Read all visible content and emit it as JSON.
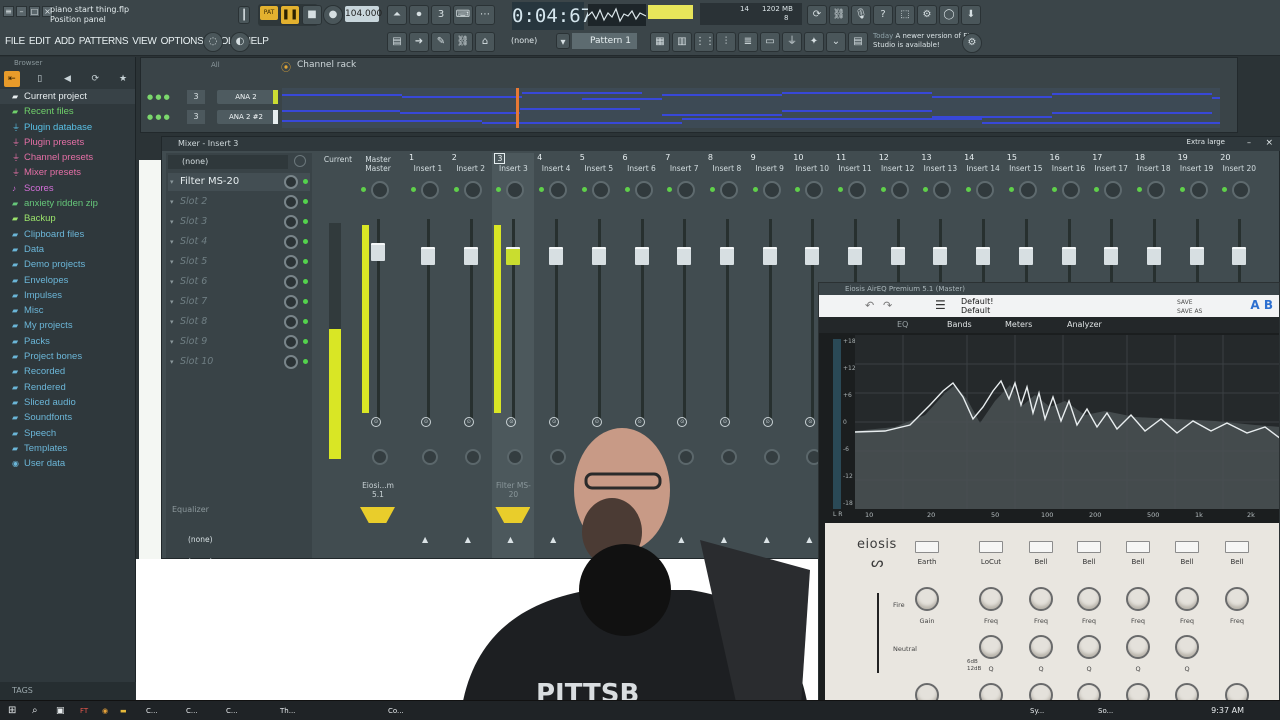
{
  "topbar": {
    "file_name": "piano start thing.flp",
    "hint": "Position panel",
    "menu": [
      "FILE",
      "EDIT",
      "ADD",
      "PATTERNS",
      "VIEW",
      "OPTIONS",
      "TOOLS",
      "HELP"
    ],
    "pat_label": "PAT",
    "tempo": "104.000",
    "time": "0:04:67",
    "cpu_value": "14",
    "ram_value": "1202 MB",
    "voices": "8",
    "route_select": "(none)",
    "pattern": "Pattern 1",
    "news_label": "Today",
    "news_text": "A newer version of FL Studio is available!"
  },
  "browser": {
    "title": "Browser",
    "items": [
      {
        "label": "Current project",
        "color": "#e8eef0",
        "icon": "folder-icon"
      },
      {
        "label": "Recent files",
        "color": "#6fcf6a",
        "icon": "folder-icon"
      },
      {
        "label": "Plugin database",
        "color": "#59c0e6",
        "icon": "plug-icon"
      },
      {
        "label": "Plugin presets",
        "color": "#e56fa6",
        "icon": "plug-icon"
      },
      {
        "label": "Channel presets",
        "color": "#e56fa6",
        "icon": "plug-icon"
      },
      {
        "label": "Mixer presets",
        "color": "#e56fa6",
        "icon": "plug-icon"
      },
      {
        "label": "Scores",
        "color": "#d36fd8",
        "icon": "note-icon"
      },
      {
        "label": "anxiety ridden zip",
        "color": "#66c77a",
        "icon": "folder-icon"
      },
      {
        "label": "Backup",
        "color": "#9be36b",
        "icon": "folder-icon"
      },
      {
        "label": "Clipboard files",
        "color": "#6bb6d8",
        "icon": "folder-icon"
      },
      {
        "label": "Data",
        "color": "#6bb6d8",
        "icon": "folder-icon"
      },
      {
        "label": "Demo projects",
        "color": "#6bb6d8",
        "icon": "folder-icon"
      },
      {
        "label": "Envelopes",
        "color": "#6bb6d8",
        "icon": "folder-icon"
      },
      {
        "label": "Impulses",
        "color": "#6bb6d8",
        "icon": "folder-icon"
      },
      {
        "label": "Misc",
        "color": "#6bb6d8",
        "icon": "folder-icon"
      },
      {
        "label": "My projects",
        "color": "#6bb6d8",
        "icon": "folder-icon"
      },
      {
        "label": "Packs",
        "color": "#6bb6d8",
        "icon": "folder-icon"
      },
      {
        "label": "Project bones",
        "color": "#6bb6d8",
        "icon": "folder-icon"
      },
      {
        "label": "Recorded",
        "color": "#6bb6d8",
        "icon": "folder-icon"
      },
      {
        "label": "Rendered",
        "color": "#6bb6d8",
        "icon": "folder-icon"
      },
      {
        "label": "Sliced audio",
        "color": "#6bb6d8",
        "icon": "folder-icon"
      },
      {
        "label": "Soundfonts",
        "color": "#6bb6d8",
        "icon": "folder-icon"
      },
      {
        "label": "Speech",
        "color": "#6bb6d8",
        "icon": "folder-icon"
      },
      {
        "label": "Templates",
        "color": "#6bb6d8",
        "icon": "folder-icon"
      },
      {
        "label": "User data",
        "color": "#6bb6d8",
        "icon": "user-icon"
      }
    ],
    "filter": "All",
    "tags": "TAGS"
  },
  "channel_rack": {
    "title": "Channel rack",
    "rows": [
      {
        "num": "3",
        "name": "ANA 2"
      },
      {
        "num": "3",
        "name": "ANA 2 #2"
      }
    ]
  },
  "mixer": {
    "title": "Mixer - Insert 3",
    "size_label": "Extra large",
    "preset": "(none)",
    "slots": [
      {
        "label": "Filter MS-20",
        "active": true
      },
      {
        "label": "Slot 2",
        "active": false
      },
      {
        "label": "Slot 3",
        "active": false
      },
      {
        "label": "Slot 4",
        "active": false
      },
      {
        "label": "Slot 5",
        "active": false
      },
      {
        "label": "Slot 6",
        "active": false
      },
      {
        "label": "Slot 7",
        "active": false
      },
      {
        "label": "Slot 8",
        "active": false
      },
      {
        "label": "Slot 9",
        "active": false
      },
      {
        "label": "Slot 10",
        "active": false
      }
    ],
    "eq_label": "Equalizer",
    "route_in": "(none)",
    "route_out": "(none)",
    "current_label": "Current",
    "master_top": "Master",
    "master_name": "Master",
    "master_fx": "Eiosi...m 5.1",
    "insert3_fx": "Filter MS-20",
    "inserts": [
      {
        "num": "1",
        "name": "Insert 1"
      },
      {
        "num": "2",
        "name": "Insert 2"
      },
      {
        "num": "3",
        "name": "Insert 3"
      },
      {
        "num": "4",
        "name": "Insert 4"
      },
      {
        "num": "5",
        "name": "Insert 5"
      },
      {
        "num": "6",
        "name": "Insert 6"
      },
      {
        "num": "7",
        "name": "Insert 7"
      },
      {
        "num": "8",
        "name": "Insert 8"
      },
      {
        "num": "9",
        "name": "Insert 9"
      },
      {
        "num": "10",
        "name": "Insert 10"
      },
      {
        "num": "11",
        "name": "Insert 11"
      },
      {
        "num": "12",
        "name": "Insert 12"
      },
      {
        "num": "13",
        "name": "Insert 13"
      },
      {
        "num": "14",
        "name": "Insert 14"
      },
      {
        "num": "15",
        "name": "Insert 15"
      },
      {
        "num": "16",
        "name": "Insert 16"
      },
      {
        "num": "17",
        "name": "Insert 17"
      },
      {
        "num": "18",
        "name": "Insert 18"
      },
      {
        "num": "19",
        "name": "Insert 19"
      },
      {
        "num": "20",
        "name": "Insert 20"
      }
    ]
  },
  "plugin": {
    "title": "Eiosis AirEQ Premium 5.1 (Master)",
    "preset_top": "Default!",
    "preset": "Default",
    "save_label": "SAVE",
    "save_as_label": "SAVE AS",
    "ab": "A B",
    "tabs": [
      "EQ",
      "Bands",
      "Meters",
      "Analyzer"
    ],
    "y_ticks": [
      "+18",
      "+12",
      "+6",
      "0",
      "-6",
      "-12",
      "-18"
    ],
    "x_ticks": [
      "10",
      "20",
      "50",
      "100",
      "200",
      "500",
      "1k",
      "2k"
    ],
    "meter_labels": "L R",
    "brand": "eiosis",
    "bands": [
      "Earth",
      "LoCut",
      "Bell",
      "Bell",
      "Bell",
      "Bell",
      "Bell"
    ],
    "knob_labels": [
      "Gain",
      "Freq",
      "Freq",
      "Freq",
      "Freq",
      "Freq",
      "Freq"
    ],
    "q_labels": [
      "Q",
      "Q",
      "Q",
      "Q",
      "Q"
    ],
    "side_labels": [
      "Fire",
      "Neutral"
    ],
    "slope_labels": [
      "6dB",
      "12dB"
    ]
  },
  "taskbar": {
    "items": [
      "C...",
      "C...",
      "C...",
      "Th...",
      "Co...",
      "Co...",
      "Sy...",
      "So..."
    ],
    "clock": "9:37 AM"
  }
}
